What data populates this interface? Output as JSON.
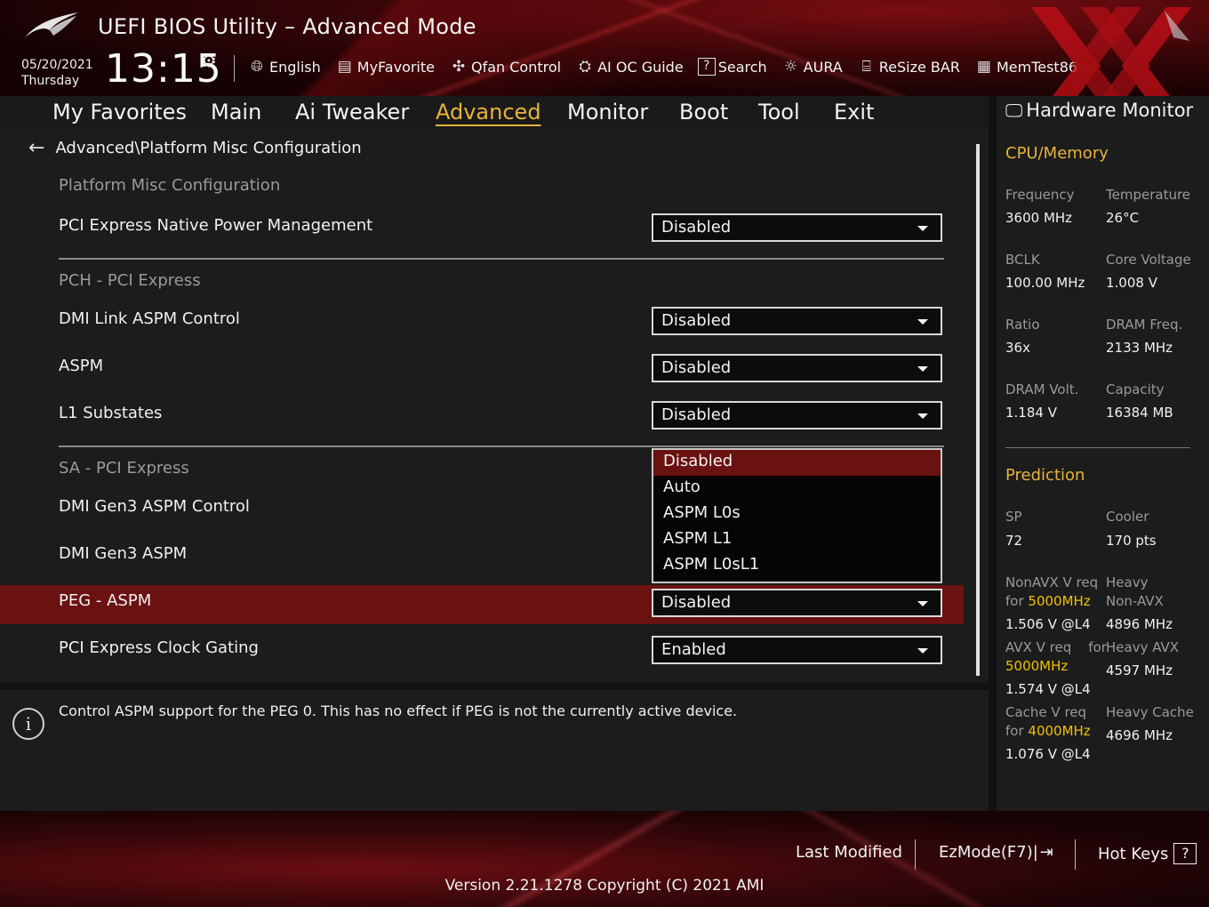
{
  "header": {
    "title": "UEFI BIOS Utility – Advanced Mode",
    "date": "05/20/2021",
    "day": "Thursday",
    "time": "13:15",
    "toolbar": [
      {
        "label": "English",
        "icon": "globe-icon"
      },
      {
        "label": "MyFavorite",
        "icon": "favorite-list-icon"
      },
      {
        "label": "Qfan Control",
        "icon": "fan-icon"
      },
      {
        "label": "AI OC Guide",
        "icon": "ai-chip-icon"
      },
      {
        "label": "Search",
        "icon": "search-help-icon"
      },
      {
        "label": "AURA",
        "icon": "aura-light-icon"
      },
      {
        "label": "ReSize BAR",
        "icon": "resize-bar-icon"
      },
      {
        "label": "MemTest86",
        "icon": "memtest-icon"
      }
    ]
  },
  "menu": {
    "items": [
      "My Favorites",
      "Main",
      "Ai Tweaker",
      "Advanced",
      "Monitor",
      "Boot",
      "Tool",
      "Exit"
    ],
    "active": "Advanced"
  },
  "settings": {
    "breadcrumb": "Advanced\\Platform Misc Configuration",
    "sections": {
      "platform": "Platform Misc Configuration",
      "pch": "PCH - PCI Express",
      "sa": "SA - PCI Express"
    },
    "rows": {
      "pcie_native_pm": {
        "label": "PCI Express Native Power Management",
        "value": "Disabled"
      },
      "dmi_link_aspm": {
        "label": "DMI Link ASPM Control",
        "value": "Disabled"
      },
      "aspm": {
        "label": "ASPM",
        "value": "Disabled"
      },
      "l1_substates": {
        "label": "L1 Substates",
        "value": "Disabled"
      },
      "dmi_gen3_aspm_control": {
        "label": "DMI Gen3 ASPM Control"
      },
      "dmi_gen3_aspm": {
        "label": "DMI Gen3 ASPM"
      },
      "peg_aspm": {
        "label": "PEG - ASPM",
        "value": "Disabled"
      },
      "pcie_clock_gating": {
        "label": "PCI Express Clock Gating",
        "value": "Enabled"
      }
    },
    "popup_options": [
      "Disabled",
      "Auto",
      "ASPM L0s",
      "ASPM L1",
      "ASPM L0sL1"
    ],
    "popup_selected": "Disabled"
  },
  "info": {
    "text": "Control ASPM support for the PEG 0.  This has no effect if PEG is not the currently active device."
  },
  "hw_monitor": {
    "title": "Hardware Monitor",
    "cpu_memory": {
      "heading": "CPU/Memory",
      "frequency_label": "Frequency",
      "frequency": "3600 MHz",
      "temperature_label": "Temperature",
      "temperature": "26°C",
      "bclk_label": "BCLK",
      "bclk": "100.00 MHz",
      "core_voltage_label": "Core Voltage",
      "core_voltage": "1.008 V",
      "ratio_label": "Ratio",
      "ratio": "36x",
      "dram_freq_label": "DRAM Freq.",
      "dram_freq": "2133 MHz",
      "dram_volt_label": "DRAM Volt.",
      "dram_volt": "1.184 V",
      "capacity_label": "Capacity",
      "capacity": "16384 MB"
    },
    "prediction": {
      "heading": "Prediction",
      "sp_label": "SP",
      "sp": "72",
      "cooler_label": "Cooler",
      "cooler": "170 pts",
      "nonavx_req_line1": "NonAVX V req",
      "nonavx_req_for": "for ",
      "nonavx_freq": "5000MHz",
      "nonavx_v": "1.506 V @L4",
      "heavy_nonavx_line1": "Heavy",
      "heavy_nonavx_line2": "Non-AVX",
      "heavy_nonavx": "4896 MHz",
      "avx_req_line1": "AVX V req    for",
      "avx_freq": "5000MHz",
      "avx_v": "1.574 V @L4",
      "heavy_avx_label": "Heavy AVX",
      "heavy_avx": "4597 MHz",
      "cache_req_line1": "Cache V req",
      "cache_req_for": "for ",
      "cache_freq": "4000MHz",
      "cache_v": "1.076 V @L4",
      "heavy_cache_label": "Heavy Cache",
      "heavy_cache": "4696 MHz"
    }
  },
  "footer": {
    "last_modified": "Last Modified",
    "ezmode": "EzMode(F7)|",
    "hot_keys": "Hot Keys",
    "hot_keys_icon": "?",
    "version": "Version 2.21.1278 Copyright (C) 2021 AMI"
  },
  "colors": {
    "accent_gold": "#e8b33b",
    "highlight_red": "#6a1111",
    "freq_yellow": "#f0c000"
  }
}
